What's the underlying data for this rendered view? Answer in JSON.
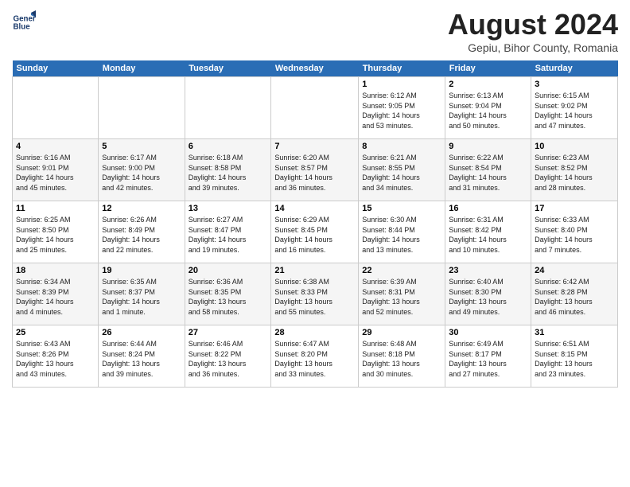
{
  "logo": {
    "line1": "General",
    "line2": "Blue"
  },
  "title": "August 2024",
  "location": "Gepiu, Bihor County, Romania",
  "days_header": [
    "Sunday",
    "Monday",
    "Tuesday",
    "Wednesday",
    "Thursday",
    "Friday",
    "Saturday"
  ],
  "weeks": [
    [
      {
        "num": "",
        "info": ""
      },
      {
        "num": "",
        "info": ""
      },
      {
        "num": "",
        "info": ""
      },
      {
        "num": "",
        "info": ""
      },
      {
        "num": "1",
        "info": "Sunrise: 6:12 AM\nSunset: 9:05 PM\nDaylight: 14 hours\nand 53 minutes."
      },
      {
        "num": "2",
        "info": "Sunrise: 6:13 AM\nSunset: 9:04 PM\nDaylight: 14 hours\nand 50 minutes."
      },
      {
        "num": "3",
        "info": "Sunrise: 6:15 AM\nSunset: 9:02 PM\nDaylight: 14 hours\nand 47 minutes."
      }
    ],
    [
      {
        "num": "4",
        "info": "Sunrise: 6:16 AM\nSunset: 9:01 PM\nDaylight: 14 hours\nand 45 minutes."
      },
      {
        "num": "5",
        "info": "Sunrise: 6:17 AM\nSunset: 9:00 PM\nDaylight: 14 hours\nand 42 minutes."
      },
      {
        "num": "6",
        "info": "Sunrise: 6:18 AM\nSunset: 8:58 PM\nDaylight: 14 hours\nand 39 minutes."
      },
      {
        "num": "7",
        "info": "Sunrise: 6:20 AM\nSunset: 8:57 PM\nDaylight: 14 hours\nand 36 minutes."
      },
      {
        "num": "8",
        "info": "Sunrise: 6:21 AM\nSunset: 8:55 PM\nDaylight: 14 hours\nand 34 minutes."
      },
      {
        "num": "9",
        "info": "Sunrise: 6:22 AM\nSunset: 8:54 PM\nDaylight: 14 hours\nand 31 minutes."
      },
      {
        "num": "10",
        "info": "Sunrise: 6:23 AM\nSunset: 8:52 PM\nDaylight: 14 hours\nand 28 minutes."
      }
    ],
    [
      {
        "num": "11",
        "info": "Sunrise: 6:25 AM\nSunset: 8:50 PM\nDaylight: 14 hours\nand 25 minutes."
      },
      {
        "num": "12",
        "info": "Sunrise: 6:26 AM\nSunset: 8:49 PM\nDaylight: 14 hours\nand 22 minutes."
      },
      {
        "num": "13",
        "info": "Sunrise: 6:27 AM\nSunset: 8:47 PM\nDaylight: 14 hours\nand 19 minutes."
      },
      {
        "num": "14",
        "info": "Sunrise: 6:29 AM\nSunset: 8:45 PM\nDaylight: 14 hours\nand 16 minutes."
      },
      {
        "num": "15",
        "info": "Sunrise: 6:30 AM\nSunset: 8:44 PM\nDaylight: 14 hours\nand 13 minutes."
      },
      {
        "num": "16",
        "info": "Sunrise: 6:31 AM\nSunset: 8:42 PM\nDaylight: 14 hours\nand 10 minutes."
      },
      {
        "num": "17",
        "info": "Sunrise: 6:33 AM\nSunset: 8:40 PM\nDaylight: 14 hours\nand 7 minutes."
      }
    ],
    [
      {
        "num": "18",
        "info": "Sunrise: 6:34 AM\nSunset: 8:39 PM\nDaylight: 14 hours\nand 4 minutes."
      },
      {
        "num": "19",
        "info": "Sunrise: 6:35 AM\nSunset: 8:37 PM\nDaylight: 14 hours\nand 1 minute."
      },
      {
        "num": "20",
        "info": "Sunrise: 6:36 AM\nSunset: 8:35 PM\nDaylight: 13 hours\nand 58 minutes."
      },
      {
        "num": "21",
        "info": "Sunrise: 6:38 AM\nSunset: 8:33 PM\nDaylight: 13 hours\nand 55 minutes."
      },
      {
        "num": "22",
        "info": "Sunrise: 6:39 AM\nSunset: 8:31 PM\nDaylight: 13 hours\nand 52 minutes."
      },
      {
        "num": "23",
        "info": "Sunrise: 6:40 AM\nSunset: 8:30 PM\nDaylight: 13 hours\nand 49 minutes."
      },
      {
        "num": "24",
        "info": "Sunrise: 6:42 AM\nSunset: 8:28 PM\nDaylight: 13 hours\nand 46 minutes."
      }
    ],
    [
      {
        "num": "25",
        "info": "Sunrise: 6:43 AM\nSunset: 8:26 PM\nDaylight: 13 hours\nand 43 minutes."
      },
      {
        "num": "26",
        "info": "Sunrise: 6:44 AM\nSunset: 8:24 PM\nDaylight: 13 hours\nand 39 minutes."
      },
      {
        "num": "27",
        "info": "Sunrise: 6:46 AM\nSunset: 8:22 PM\nDaylight: 13 hours\nand 36 minutes."
      },
      {
        "num": "28",
        "info": "Sunrise: 6:47 AM\nSunset: 8:20 PM\nDaylight: 13 hours\nand 33 minutes."
      },
      {
        "num": "29",
        "info": "Sunrise: 6:48 AM\nSunset: 8:18 PM\nDaylight: 13 hours\nand 30 minutes."
      },
      {
        "num": "30",
        "info": "Sunrise: 6:49 AM\nSunset: 8:17 PM\nDaylight: 13 hours\nand 27 minutes."
      },
      {
        "num": "31",
        "info": "Sunrise: 6:51 AM\nSunset: 8:15 PM\nDaylight: 13 hours\nand 23 minutes."
      }
    ]
  ]
}
